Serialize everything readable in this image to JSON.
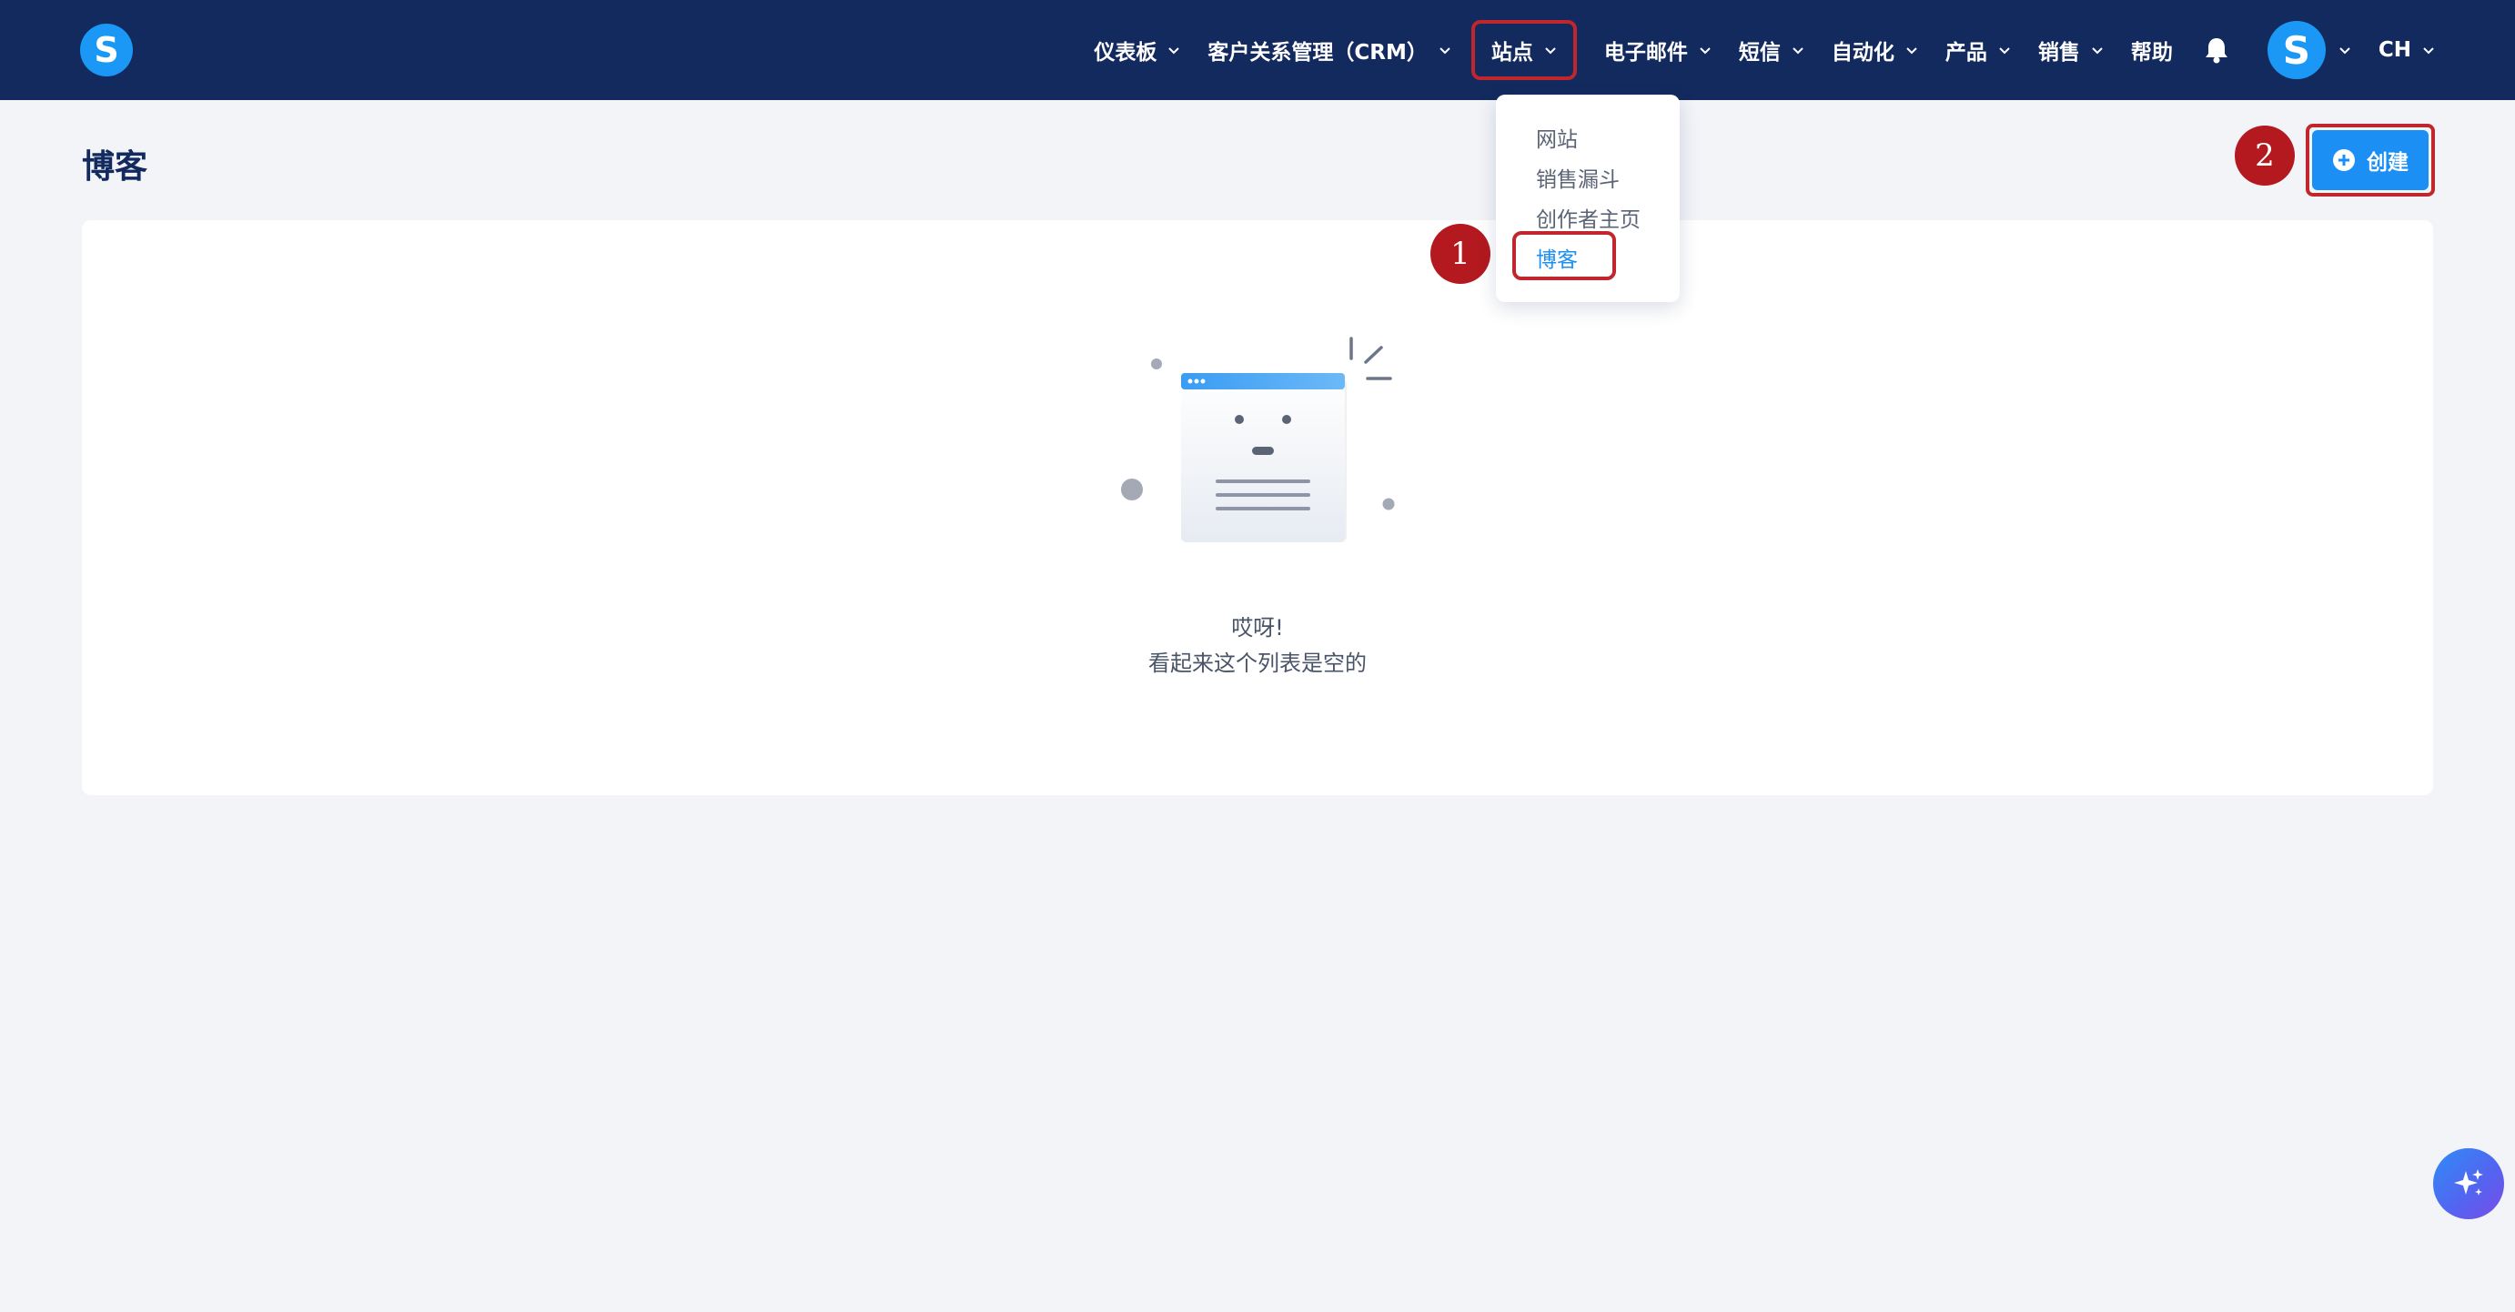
{
  "header": {
    "logo_letter": "S",
    "nav": [
      {
        "label": "仪表板"
      },
      {
        "label": "客户关系管理（CRM）"
      },
      {
        "label": "站点"
      },
      {
        "label": "电子邮件"
      },
      {
        "label": "短信"
      },
      {
        "label": "自动化"
      },
      {
        "label": "产品"
      },
      {
        "label": "销售"
      },
      {
        "label": "帮助"
      }
    ],
    "avatar_letter": "S",
    "language": "CH"
  },
  "dropdown": {
    "items": [
      {
        "label": "网站"
      },
      {
        "label": "销售漏斗"
      },
      {
        "label": "创作者主页"
      },
      {
        "label": "博客"
      }
    ],
    "active_item": "博客"
  },
  "page": {
    "title": "博客",
    "create_label": "创建"
  },
  "steps": {
    "step1": "1",
    "step2": "2"
  },
  "empty_state": {
    "line1": "哎呀!",
    "line2": "看起来这个列表是空的"
  },
  "icons": {
    "bell": "bell-icon",
    "plus": "plus-circle-icon",
    "ai": "sparkles-icon",
    "chevron": "chevron-down-icon"
  },
  "colors": {
    "header_bg": "#132a5f",
    "accent": "#1b8ff3",
    "highlight": "#c0262c",
    "step_badge": "#b3191f",
    "page_bg": "#f2f4f8"
  }
}
